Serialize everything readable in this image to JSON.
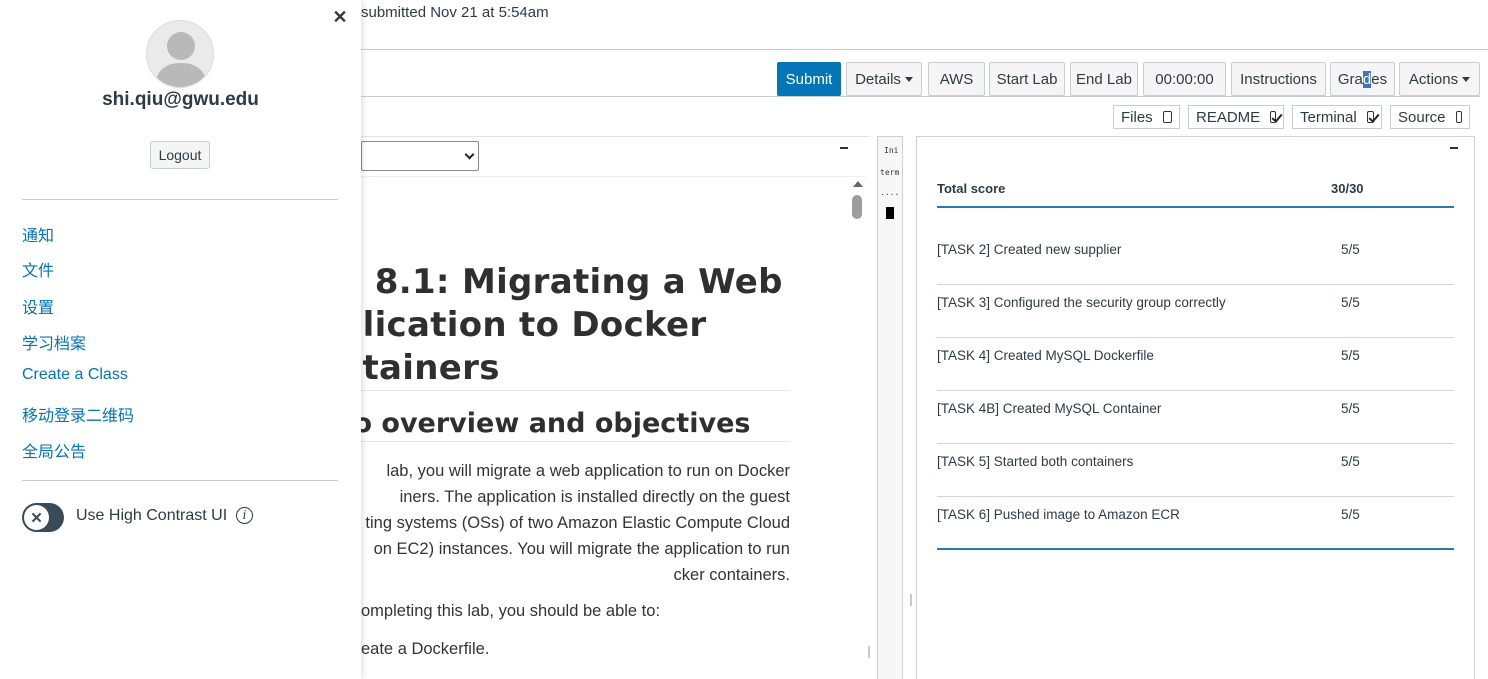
{
  "header": {
    "submitted_text": "submitted Nov 21 at 5:54am"
  },
  "toolbar": {
    "submit": "Submit",
    "details": "Details",
    "aws": "AWS",
    "start_lab": "Start Lab",
    "end_lab": "End Lab",
    "timer": "00:00:00",
    "instructions": "Instructions",
    "grades_pre": "Gra",
    "grades_hl": "d",
    "grades_post": "es",
    "actions": "Actions"
  },
  "view_toggles": {
    "files": {
      "label": "Files",
      "checked": false
    },
    "readme": {
      "label": "README",
      "checked": true
    },
    "terminal": {
      "label": "Terminal",
      "checked": true
    },
    "source": {
      "label": "Source",
      "checked": false
    }
  },
  "readme": {
    "title_lines": [
      "b 8.1: Migrating a Web",
      "plication to Docker",
      "ntainers"
    ],
    "section_heading": "overview and objectives",
    "intro_lines": [
      "lab, you will migrate a web application to run on Docker",
      "iners. The application is installed directly on the guest",
      "ting systems (OSs) of two Amazon Elastic Compute Cloud",
      "on EC2) instances. You will migrate the application to run",
      "cker containers."
    ],
    "after_text": "ompleting this lab, you should be able to:",
    "bullet_1": "eate a Dockerfile."
  },
  "terminal": {
    "lines": [
      "Ini",
      "term",
      "...."
    ]
  },
  "grades": {
    "total_label": "Total score",
    "total_value": "30/30",
    "rows": [
      {
        "name": "[TASK 2] Created new supplier",
        "score": "5/5"
      },
      {
        "name": "[TASK 3] Configured the security group correctly",
        "score": "5/5"
      },
      {
        "name": "[TASK 4] Created MySQL Dockerfile",
        "score": "5/5"
      },
      {
        "name": "[TASK 4B] Created MySQL Container",
        "score": "5/5"
      },
      {
        "name": "[TASK 5] Started both containers",
        "score": "5/5"
      },
      {
        "name": "[TASK 6] Pushed image to Amazon ECR",
        "score": "5/5"
      }
    ]
  },
  "tray": {
    "email": "shi.qiu@gwu.edu",
    "logout": "Logout",
    "links": [
      "通知",
      "文件",
      "设置",
      "学习档案",
      "Create a Class",
      "移动登录二维码",
      "全局公告"
    ],
    "contrast_label": "Use High Contrast UI",
    "contrast_enabled": false
  },
  "colors": {
    "primary": "#0374b5",
    "link": "#0374b5",
    "text": "#2d3b45",
    "grade_rule": "#2a7ab0"
  }
}
